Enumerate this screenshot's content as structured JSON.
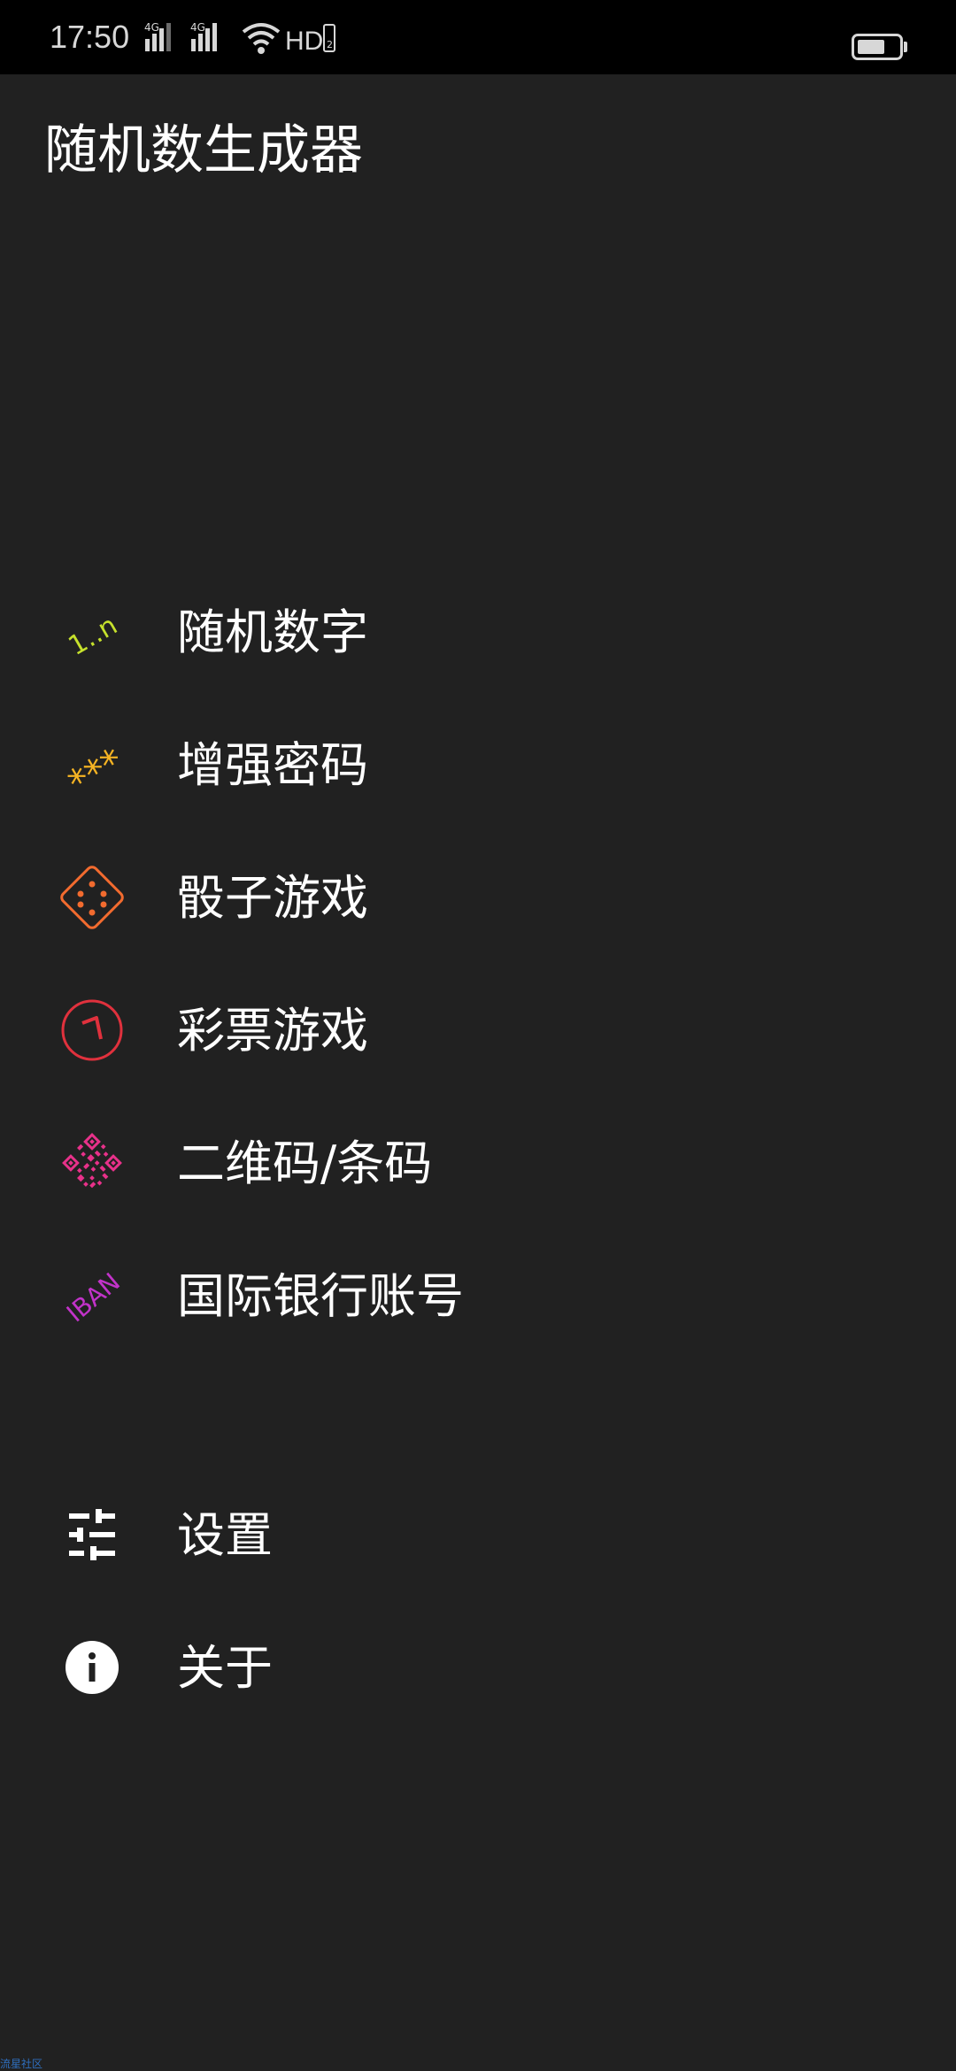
{
  "status_bar": {
    "time": "17:50",
    "signal_1_label": "4G",
    "signal_2_label": "4G",
    "hd_label": "HD",
    "hd_sub": "2",
    "icons": [
      "signal-4g-icon",
      "signal-4g-icon",
      "wifi-icon",
      "hd-icon",
      "battery-icon"
    ]
  },
  "app": {
    "title": "随机数生成器"
  },
  "menu": {
    "items": [
      {
        "label": "随机数字",
        "icon": "number-range-icon",
        "icon_text": "1..n",
        "color": "#c6e12c"
      },
      {
        "label": "增强密码",
        "icon": "password-icon",
        "icon_text": "***",
        "color": "#f5b323"
      },
      {
        "label": "骰子游戏",
        "icon": "dice-icon",
        "color": "#f26b2f"
      },
      {
        "label": "彩票游戏",
        "icon": "lottery-icon",
        "color": "#e0313d"
      },
      {
        "label": "二维码/条码",
        "icon": "qr-code-icon",
        "color": "#e8318a"
      },
      {
        "label": "国际银行账号",
        "icon": "iban-icon",
        "icon_text": "IBAN",
        "color": "#c233c9"
      }
    ],
    "secondary": [
      {
        "label": "设置",
        "icon": "settings-sliders-icon",
        "color": "#ffffff"
      },
      {
        "label": "关于",
        "icon": "info-icon",
        "color": "#ffffff"
      }
    ]
  },
  "watermark": "流星社区"
}
